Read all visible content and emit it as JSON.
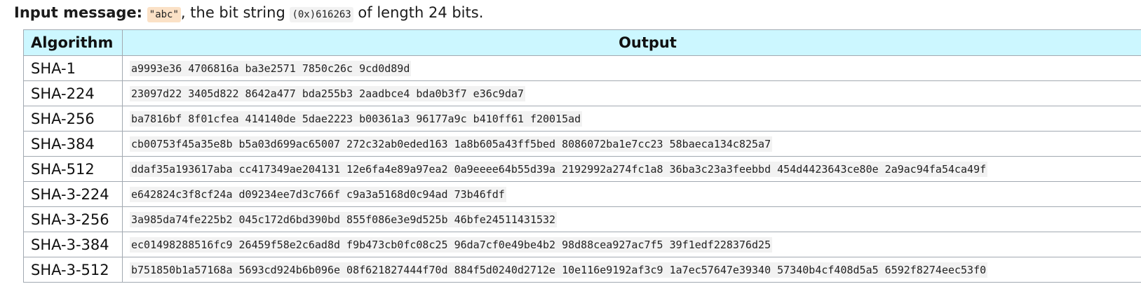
{
  "intro": {
    "label": "Input message:",
    "message": "\"abc\"",
    "middle": ", the bit string ",
    "bits": "(0x)616263",
    "tail": " of length 24 bits."
  },
  "table": {
    "headers": [
      "Algorithm",
      "Output"
    ],
    "rows": [
      {
        "algorithm": "SHA-1",
        "output": "a9993e36 4706816a ba3e2571 7850c26c 9cd0d89d"
      },
      {
        "algorithm": "SHA-224",
        "output": "23097d22 3405d822 8642a477 bda255b3 2aadbce4 bda0b3f7 e36c9da7"
      },
      {
        "algorithm": "SHA-256",
        "output": "ba7816bf 8f01cfea 414140de 5dae2223 b00361a3 96177a9c b410ff61 f20015ad"
      },
      {
        "algorithm": "SHA-384",
        "output": "cb00753f45a35e8b b5a03d699ac65007 272c32ab0eded163 1a8b605a43ff5bed 8086072ba1e7cc23 58baeca134c825a7"
      },
      {
        "algorithm": "SHA-512",
        "output": "ddaf35a193617aba cc417349ae204131 12e6fa4e89a97ea2 0a9eeee64b55d39a 2192992a274fc1a8 36ba3c23a3feebbd 454d4423643ce80e 2a9ac94fa54ca49f"
      },
      {
        "algorithm": "SHA-3-224",
        "output": "e642824c3f8cf24a d09234ee7d3c766f c9a3a5168d0c94ad 73b46fdf"
      },
      {
        "algorithm": "SHA-3-256",
        "output": "3a985da74fe225b2 045c172d6bd390bd 855f086e3e9d525b 46bfe24511431532"
      },
      {
        "algorithm": "SHA-3-384",
        "output": "ec01498288516fc9 26459f58e2c6ad8d f9b473cb0fc08c25 96da7cf0e49be4b2 98d88cea927ac7f5 39f1edf228376d25"
      },
      {
        "algorithm": "SHA-3-512",
        "output": "b751850b1a57168a 5693cd924b6b096e 08f621827444f70d 884f5d0240d2712e 10e116e9192af3c9 1a7ec57647e39340 57340b4cf408d5a5 6592f8274eec53f0"
      }
    ]
  }
}
